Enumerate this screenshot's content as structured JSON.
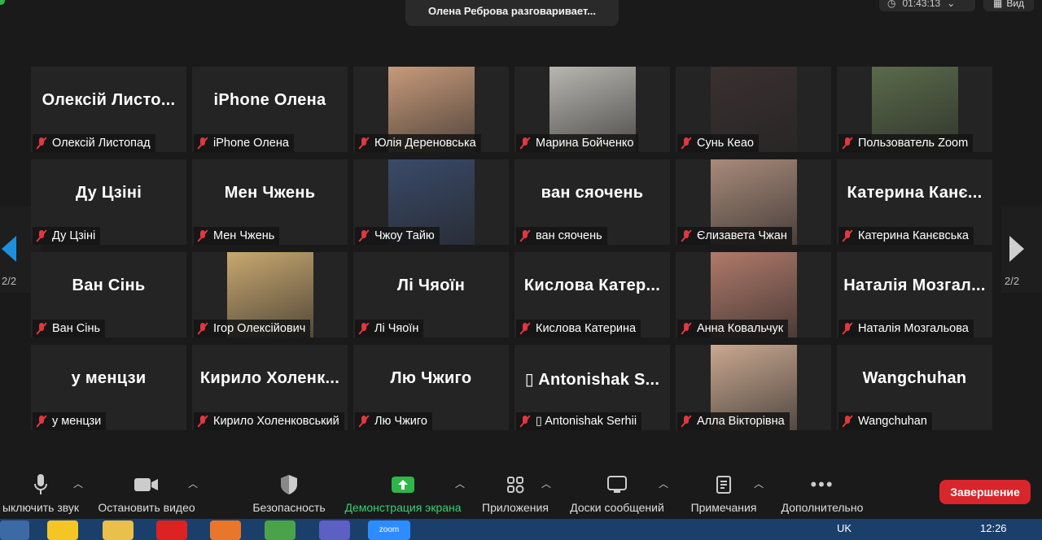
{
  "speaking": "Олена Реброва разговаривает...",
  "timer": "01:43:13",
  "view_label": "Вид",
  "pages": {
    "left": "2/2",
    "right": "2/2"
  },
  "tiles": [
    {
      "big": "Олексій Листо...",
      "name": "Олексій Листопад"
    },
    {
      "big": "iPhone Олена",
      "name": "iPhone Олена"
    },
    {
      "big": "",
      "name": "Юлія Дереновська",
      "photo": "#c79a7a"
    },
    {
      "big": "",
      "name": "Марина Бойченко",
      "photo": "#b8b6b0"
    },
    {
      "big": "",
      "name": "Сунь Кеао",
      "photo": "#3a3030"
    },
    {
      "big": "",
      "name": "Пользователь Zoom",
      "photo": "#5a6a4a"
    },
    {
      "big": "Ду Цзіні",
      "name": "Ду Цзіні"
    },
    {
      "big": "Мен Чжень",
      "name": "Мен Чжень"
    },
    {
      "big": "",
      "name": "Чжоу Тайю",
      "photo": "#3a4a6a"
    },
    {
      "big": "ван сяочень",
      "name": "ван сяочень"
    },
    {
      "big": "",
      "name": "Єлизавета Чжан",
      "photo": "#a88a7a"
    },
    {
      "big": "Катерина Канє...",
      "name": "Катерина Канєвська"
    },
    {
      "big": "Ван Сінь",
      "name": "Ван Сінь"
    },
    {
      "big": "",
      "name": "Ігор Олексійович",
      "photo": "#c8a870"
    },
    {
      "big": "Лі Чяоїн",
      "name": "Лі Чяоїн"
    },
    {
      "big": "Кислова Катер...",
      "name": "Кислова Катерина"
    },
    {
      "big": "",
      "name": "Анна Ковальчук",
      "photo": "#b07a6a"
    },
    {
      "big": "Наталія Мозгал...",
      "name": "Наталія Мозгальова"
    },
    {
      "big": "у менцзи",
      "name": "у менцзи"
    },
    {
      "big": "Кирило Холенк...",
      "name": "Кирило Холенковський"
    },
    {
      "big": "Лю Чжиго",
      "name": "Лю Чжиго"
    },
    {
      "big": "▯ Antonishak S...",
      "name": "▯ Antonishak Serhii"
    },
    {
      "big": "",
      "name": "Алла Вікторівна",
      "photo": "#c9a890"
    },
    {
      "big": "Wangchuhan",
      "name": "Wangchuhan"
    }
  ],
  "toolbar": {
    "mute": "ыключить звук",
    "video": "Остановить видео",
    "security": "Безопасность",
    "share": "Демонстрация экрана",
    "apps": "Приложения",
    "whiteboards": "Доски сообщений",
    "notes": "Примечания",
    "more": "Дополнительно",
    "end": "Завершение"
  },
  "taskbar": {
    "lang": "UK",
    "time": "12:26",
    "zoom_label": "zoom"
  },
  "colors": {
    "accent_green": "#2fb54a",
    "end_red": "#d8262c",
    "mic_red": "#e0383e",
    "nav_blue": "#1e8fdc"
  }
}
